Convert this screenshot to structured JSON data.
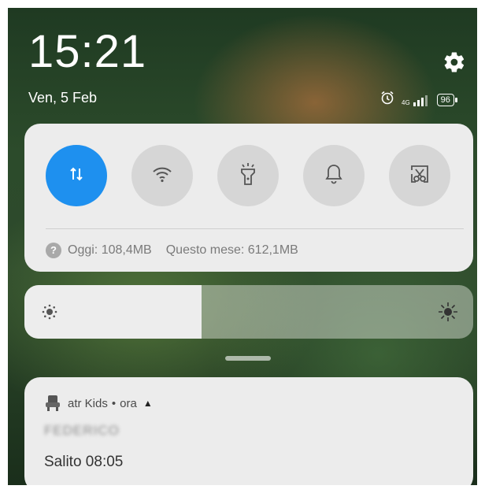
{
  "status_header": {
    "time": "15:21",
    "date": "Ven, 5 Feb",
    "network_label": "4G",
    "battery": "96"
  },
  "quick_settings": {
    "tiles": [
      {
        "name": "mobile-data",
        "icon": "data-transfer-icon",
        "active": true
      },
      {
        "name": "wifi",
        "icon": "wifi-icon",
        "active": false
      },
      {
        "name": "flashlight",
        "icon": "flashlight-icon",
        "active": false
      },
      {
        "name": "sound",
        "icon": "bell-icon",
        "active": false
      },
      {
        "name": "screenshot",
        "icon": "scissors-screenshot-icon",
        "active": false
      }
    ],
    "usage": {
      "today": "Oggi: 108,4MB",
      "month": "Questo mese: 612,1MB"
    }
  },
  "brightness": {
    "level": 0.395
  },
  "notification": {
    "app_name": "atr Kids",
    "separator": "•",
    "when": "ora",
    "sender_blurred": "FEDERICO",
    "message": "Salito 08:05"
  },
  "colors": {
    "accent": "#1e90ef",
    "tile_inactive": "#d6d6d6",
    "card": "#ececec"
  }
}
